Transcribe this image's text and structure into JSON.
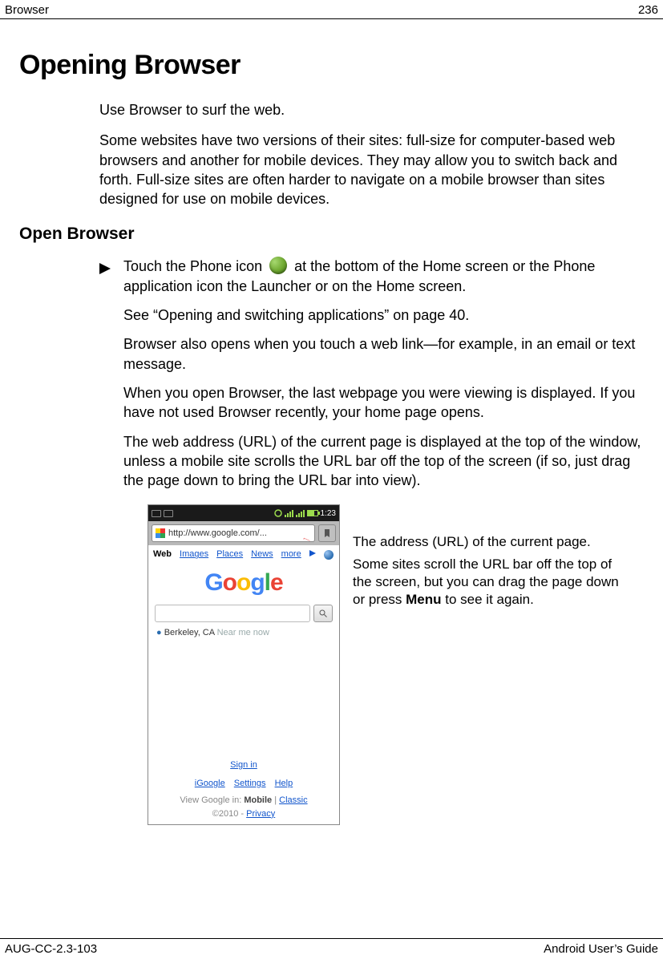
{
  "header": {
    "left": "Browser",
    "right": "236"
  },
  "title": "Opening Browser",
  "intro": {
    "p1": "Use Browser to surf the web.",
    "p2": "Some websites have two versions of their sites: full-size for computer-based web browsers and another for mobile devices. They may allow you to switch back and forth. Full-size sites are often harder to navigate on a mobile browser than sites designed for use on mobile devices."
  },
  "section": "Open Browser",
  "steps": {
    "s1a": "Touch the Phone icon ",
    "s1b": " at the bottom of the Home screen or the Phone application icon the Launcher or on the Home screen.",
    "p2": "See “Opening and switching applications” on page 40.",
    "p3": "Browser also opens when you touch a web link—for example, in an email or text message.",
    "p4": "When you open Browser, the last webpage you were viewing is displayed. If you have not used Browser recently, your home page opens.",
    "p5": "The web address (URL) of the current page is displayed at the top of the window, unless a mobile site scrolls the URL bar off the top of the screen (if so, just drag the page down to bring the URL bar into view)."
  },
  "phone": {
    "time": "1:23",
    "url": "http://www.google.com/...",
    "tabs": {
      "t0": "Web",
      "t1": "Images",
      "t2": "Places",
      "t3": "News",
      "more": "more"
    },
    "logo": {
      "c1": "G",
      "c2": "o",
      "c3": "o",
      "c4": "g",
      "c5": "l",
      "c6": "e"
    },
    "location": {
      "city": "Berkeley, CA",
      "near": "Near me now"
    },
    "links": {
      "signin": "Sign in",
      "igoogle": "iGoogle",
      "settings": "Settings",
      "help": "Help",
      "view_prefix": "View Google in: ",
      "mobile": "Mobile",
      "sep": " | ",
      "classic": "Classic",
      "copy_prefix": "©2010 - ",
      "privacy": "Privacy"
    }
  },
  "callout": {
    "line1": "The address (URL) of the current page.",
    "line2a": "Some sites scroll the URL bar off the top of the screen, but you can drag the page down or press ",
    "menu": "Menu",
    "line2b": " to see it again."
  },
  "footer": {
    "left": "AUG-CC-2.3-103",
    "right": "Android User’s Guide"
  }
}
